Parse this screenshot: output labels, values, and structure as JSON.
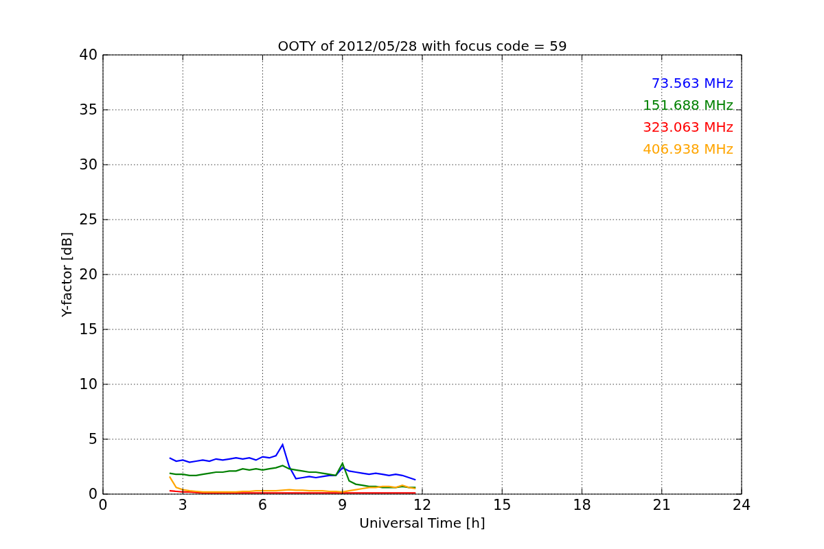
{
  "chart_data": {
    "type": "line",
    "title": "OOTY of 2012/05/28 with focus code = 59",
    "xlabel": "Universal Time [h]",
    "ylabel": "Y-factor [dB]",
    "x": [
      2.5,
      2.75,
      3,
      3.25,
      3.5,
      3.75,
      4,
      4.25,
      4.5,
      4.75,
      5,
      5.25,
      5.5,
      5.75,
      6,
      6.25,
      6.5,
      6.75,
      7,
      7.25,
      7.5,
      7.75,
      8,
      8.25,
      8.5,
      8.75,
      9,
      9.25,
      9.5,
      9.75,
      10,
      10.25,
      10.5,
      10.75,
      11,
      11.25,
      11.5,
      11.75
    ],
    "series": [
      {
        "name": "73.563 MHz",
        "color": "#0000ff",
        "values": [
          3.3,
          3.0,
          3.1,
          2.9,
          3.0,
          3.1,
          3.0,
          3.2,
          3.1,
          3.2,
          3.3,
          3.2,
          3.3,
          3.1,
          3.4,
          3.3,
          3.5,
          4.5,
          2.5,
          1.4,
          1.5,
          1.6,
          1.5,
          1.6,
          1.7,
          1.7,
          2.4,
          2.1,
          2.0,
          1.9,
          1.8,
          1.9,
          1.8,
          1.7,
          1.8,
          1.7,
          1.5,
          1.3
        ]
      },
      {
        "name": "151.688 MHz",
        "color": "#008000",
        "values": [
          1.9,
          1.8,
          1.8,
          1.7,
          1.7,
          1.8,
          1.9,
          2.0,
          2.0,
          2.1,
          2.1,
          2.3,
          2.2,
          2.3,
          2.2,
          2.3,
          2.4,
          2.6,
          2.3,
          2.2,
          2.1,
          2.0,
          2.0,
          1.9,
          1.8,
          1.7,
          2.8,
          1.2,
          0.9,
          0.8,
          0.7,
          0.7,
          0.6,
          0.6,
          0.6,
          0.7,
          0.6,
          0.6
        ]
      },
      {
        "name": "323.063 MHz",
        "color": "#ff0000",
        "values": [
          0.3,
          0.25,
          0.2,
          0.2,
          0.15,
          0.1,
          0.1,
          0.1,
          0.1,
          0.1,
          0.1,
          0.1,
          0.1,
          0.1,
          0.1,
          0.1,
          0.1,
          0.1,
          0.1,
          0.1,
          0.1,
          0.1,
          0.1,
          0.1,
          0.1,
          0.1,
          0.1,
          0.1,
          0.1,
          0.1,
          0.1,
          0.1,
          0.1,
          0.1,
          0.1,
          0.1,
          0.1,
          0.1
        ]
      },
      {
        "name": "406.938 MHz",
        "color": "#ffa500",
        "values": [
          1.6,
          0.6,
          0.4,
          0.3,
          0.25,
          0.2,
          0.2,
          0.2,
          0.2,
          0.2,
          0.2,
          0.25,
          0.25,
          0.3,
          0.3,
          0.3,
          0.3,
          0.35,
          0.4,
          0.35,
          0.35,
          0.3,
          0.3,
          0.3,
          0.25,
          0.25,
          0.2,
          0.3,
          0.4,
          0.5,
          0.6,
          0.6,
          0.7,
          0.7,
          0.6,
          0.8,
          0.6,
          0.5
        ]
      }
    ],
    "xlim": [
      0,
      24
    ],
    "ylim": [
      0,
      40
    ],
    "xticks": [
      0,
      3,
      6,
      9,
      12,
      15,
      18,
      21,
      24
    ],
    "yticks": [
      0,
      5,
      10,
      15,
      20,
      25,
      30,
      35,
      40
    ],
    "grid": true
  }
}
